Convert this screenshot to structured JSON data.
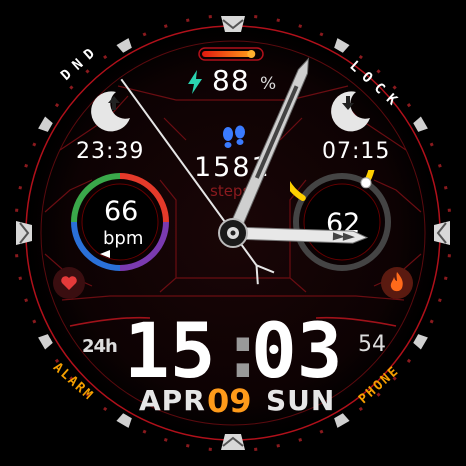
{
  "battery": {
    "value": "88",
    "unit": "%",
    "level": 0.88
  },
  "alarm_time": "23:39",
  "lock_time": "07:15",
  "steps": {
    "value": "1581",
    "label": "steps"
  },
  "heart_rate": {
    "value": "66",
    "unit": "bpm"
  },
  "right_gauge": {
    "value": "62",
    "level": 0.75
  },
  "labels": {
    "dnd": "DND",
    "lock": "LOCK",
    "alarm": "ALARM",
    "phone": "PHONE",
    "format": "24h"
  },
  "time": {
    "hours": "15",
    "sep": ":",
    "minutes": "03",
    "seconds": "54"
  },
  "date": {
    "month": "APR",
    "day": "09",
    "weekday": "SUN"
  },
  "analog": {
    "hour": 3,
    "minute": 3,
    "second": 54
  },
  "colors": {
    "accent_red": "#c8141c",
    "date_orange": "#ff9a1a",
    "label_orange": "#f5a000",
    "steps_blue": "#3a7bff",
    "bolt_teal": "#2ad3b0",
    "gauge_yellow": "#ffd000"
  },
  "icons": [
    "moon-up-icon",
    "moon-down-icon",
    "bolt-icon",
    "footsteps-icon",
    "heart-icon",
    "flame-icon"
  ]
}
